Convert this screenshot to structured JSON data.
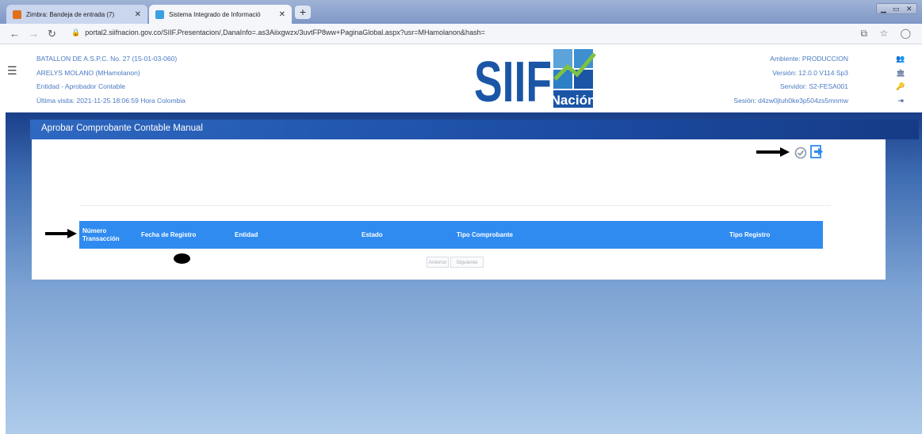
{
  "browser": {
    "tabs": [
      {
        "title": "Zimbra: Bandeja de entrada (7)",
        "active": false
      },
      {
        "title": "Sistema Integrado de Informació",
        "active": true
      }
    ],
    "new_tab": "+",
    "url": "portal2.siifnacion.gov.co/SIIF.Presentacion/,DanaInfo=.as3Aiixgwzx/3uvtFP8ww+PaginaGlobal.aspx?usr=MHamolanon&hash="
  },
  "header": {
    "user_lines": [
      "BATALLON DE A.S.P.C. No. 27 (15-01-03-060)",
      "ARELYS MOLANO (MHamolanon)",
      "Entidad - Aprobador Contable",
      "Última visita: 2021-11-25 18:06:59 Hora Colombia"
    ],
    "logo_text": "SIIF",
    "logo_subtext": "Nación",
    "server_lines": [
      "Ambiente: PRODUCCION",
      "Versión: 12.0.0 V114 Sp3",
      "Servidor: S2-FESA001",
      "Sesión: d4zw0jtuh0ke3p504zs5mnmw"
    ]
  },
  "panel": {
    "title": "Aprobar Comprobante Contable Manual",
    "columns": [
      "Número Transacción",
      "Fecha de Registro",
      "Entidad",
      "Estado",
      "Tipo Comprobante",
      "Tipo Registro"
    ],
    "pager": {
      "prev": "Anterior",
      "next": "Siguiente"
    }
  },
  "colors": {
    "header_blue": "#1c4ca4",
    "table_header": "#2f8bf0",
    "info_text": "#4a7ac2"
  }
}
